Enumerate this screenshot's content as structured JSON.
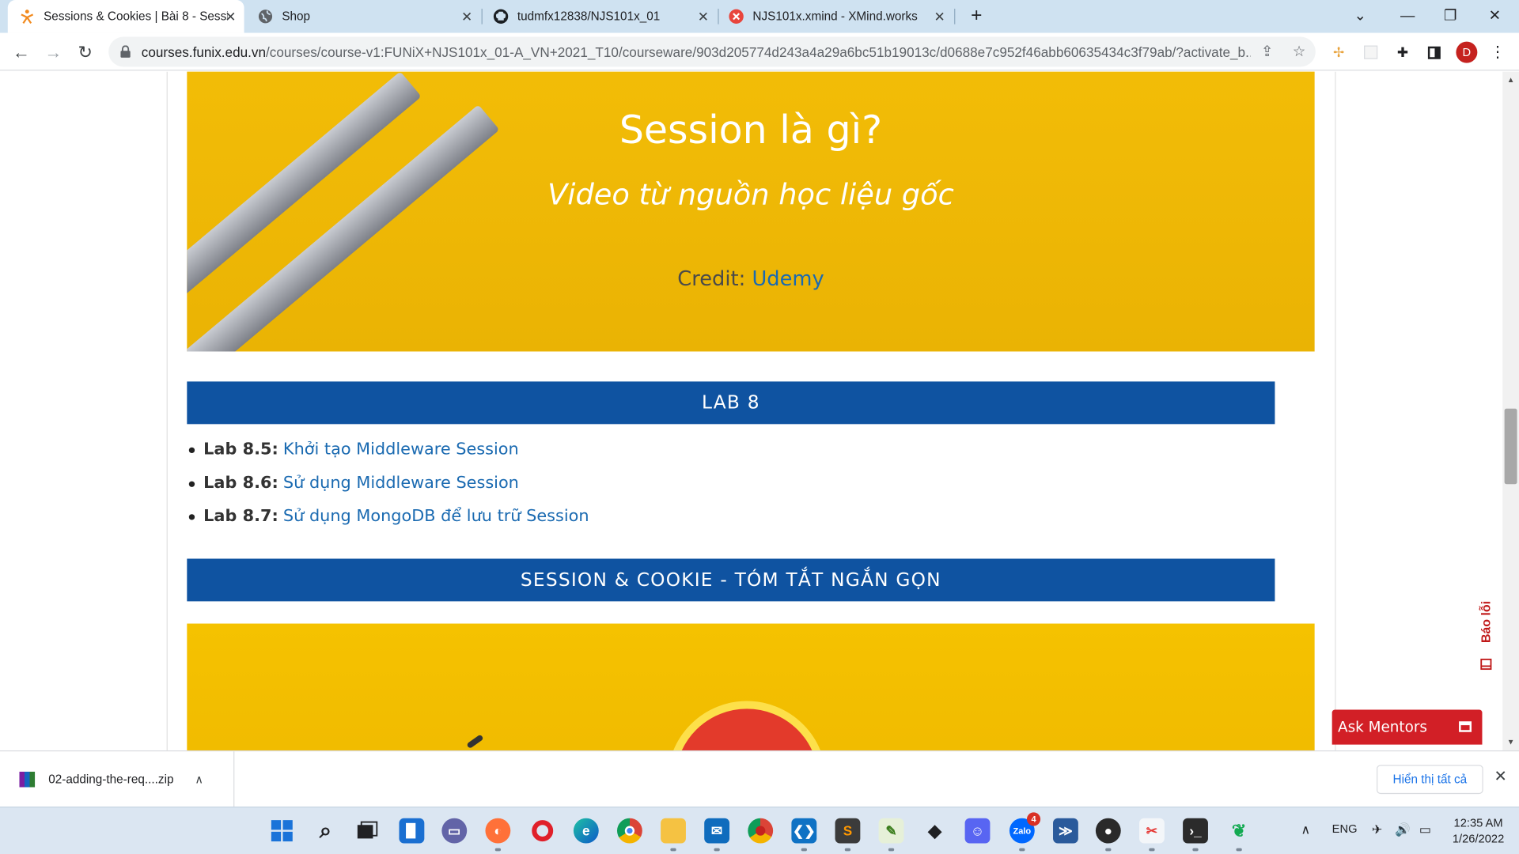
{
  "browser": {
    "tabs": [
      {
        "title": "Sessions & Cookies | Bài 8 - Session",
        "favicon": "funix-icon",
        "active": true
      },
      {
        "title": "Shop",
        "favicon": "globe-icon",
        "active": false
      },
      {
        "title": "tudmfx12838/NJS101x_01",
        "favicon": "github-icon",
        "active": false
      },
      {
        "title": "NJS101x.xmind - XMind.works",
        "favicon": "xmind-icon",
        "active": false
      }
    ],
    "url_host": "courses.funix.edu.vn",
    "url_path": "/courses/course-v1:FUNiX+NJS101x_01-A_VN+2021_T10/courseware/903d205774d243a4a29a6bc51b19013c/d0688e7c952f46abb60635434c3f79ab/?activate_b...",
    "profile_initial": "D"
  },
  "page": {
    "hero_title": "Session là gì?",
    "hero_subtitle": "Video từ nguồn học liệu gốc",
    "credit_label": "Credit:",
    "credit_link": "Udemy",
    "lab_banner": "LAB 8",
    "labs": [
      {
        "code": "Lab 8.5:",
        "title": "Khởi tạo Middleware Session"
      },
      {
        "code": "Lab 8.6:",
        "title": "Sử dụng Middleware Session"
      },
      {
        "code": "Lab 8.7:",
        "title": "Sử dụng MongoDB để lưu trữ Session"
      }
    ],
    "summary_banner": "SESSION & COOKIE - TÓM TẮT NGẮN GỌN",
    "report_label": "Báo lỗi",
    "ask_mentors": "Ask Mentors"
  },
  "downloads": {
    "file_name": "02-adding-the-req....zip",
    "show_all": "Hiển thị tất cả"
  },
  "taskbar": {
    "language": "ENG",
    "time": "12:35 AM",
    "date": "1/26/2022",
    "discord_badge": "4"
  },
  "colors": {
    "banner_blue": "#0f53a1",
    "hero_yellow": "#f0b800",
    "link_blue": "#1a6ab1",
    "ask_red": "#d21f26"
  }
}
